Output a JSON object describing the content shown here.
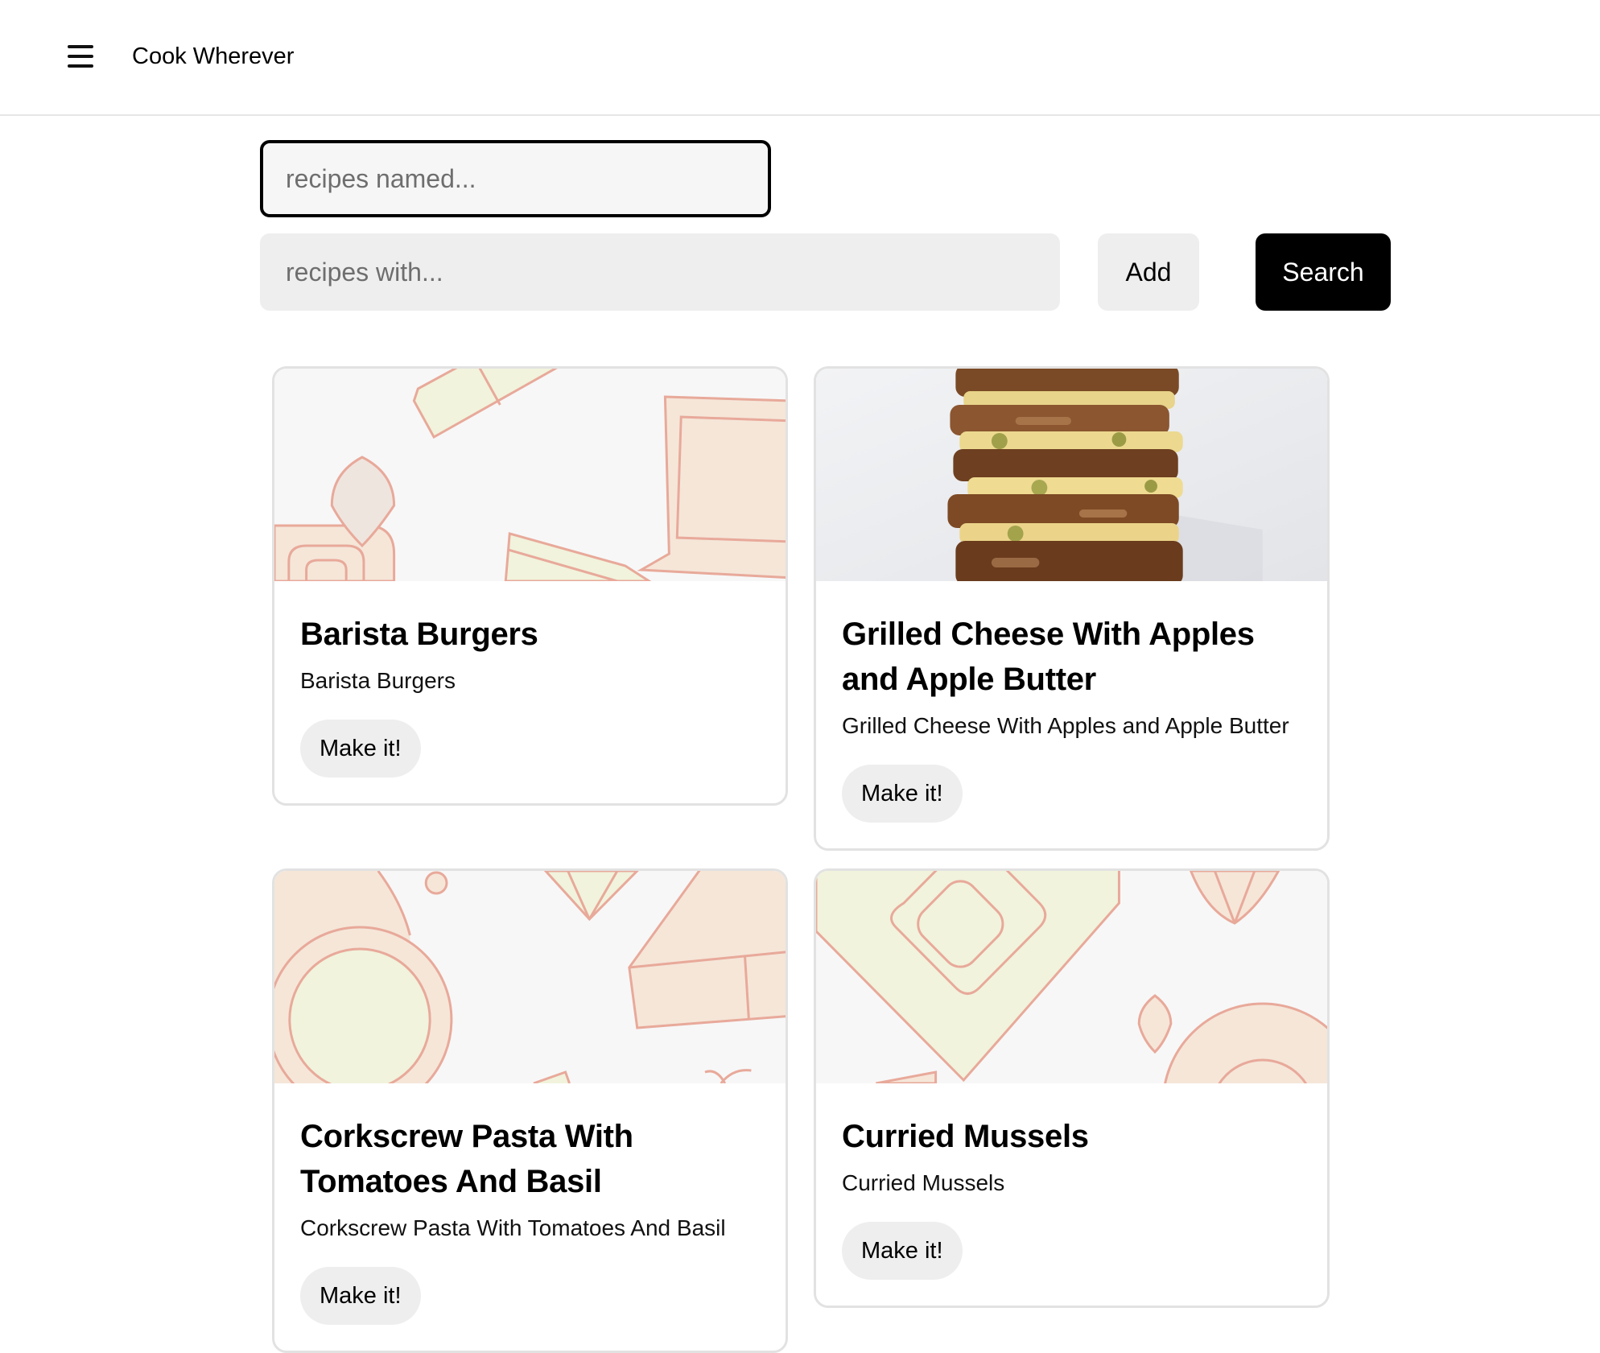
{
  "header": {
    "app_title": "Cook Wherever",
    "menu_icon": "hamburger-menu-icon"
  },
  "search": {
    "name_placeholder": "recipes named...",
    "name_value": "",
    "ingredients_placeholder": "recipes with...",
    "ingredients_value": "",
    "add_label": "Add",
    "search_label": "Search"
  },
  "recipes": [
    {
      "title": "Barista Burgers",
      "subtitle": "Barista Burgers",
      "button_label": "Make it!",
      "image": "placeholder-pattern"
    },
    {
      "title": "Grilled Cheese With Apples and Apple Butter",
      "subtitle": "Grilled Cheese With Apples and Apple Butter",
      "button_label": "Make it!",
      "image": "grilled-cheese-photo"
    },
    {
      "title": "Corkscrew Pasta With Tomatoes And Basil",
      "subtitle": "Corkscrew Pasta With Tomatoes And Basil",
      "button_label": "Make it!",
      "image": "placeholder-pattern"
    },
    {
      "title": "Curried Mussels",
      "subtitle": "Curried Mussels",
      "button_label": "Make it!",
      "image": "placeholder-pattern"
    }
  ],
  "colors": {
    "accent": "#000000",
    "pattern_stroke": "#e8a99a",
    "pattern_peach": "#f5e6d8",
    "pattern_green": "#f1f3dc",
    "pattern_bg": "#f7f7f7"
  }
}
